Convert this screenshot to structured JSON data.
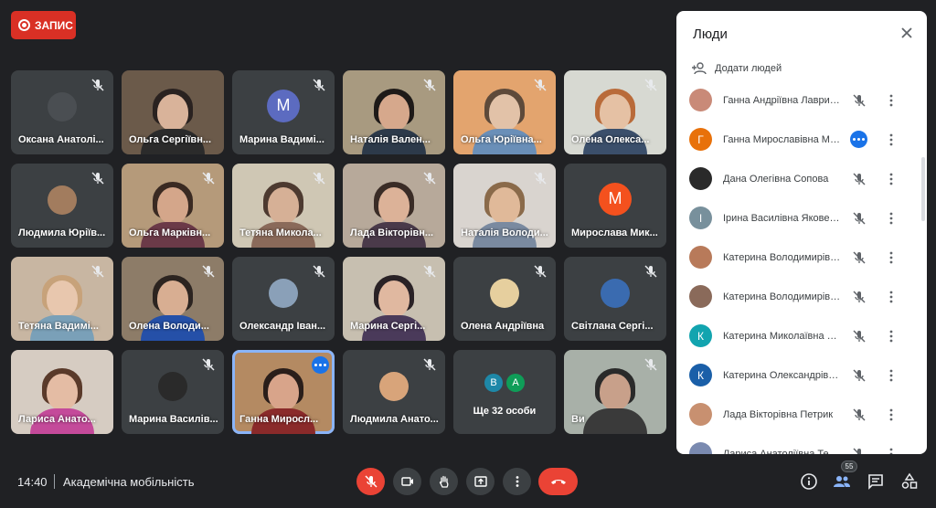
{
  "recording": {
    "label": "ЗАПИС"
  },
  "tiles": [
    {
      "name": "Оксана Анатолі...",
      "type": "photo-avatar",
      "mic_off": true,
      "bg": "#3c4043",
      "av": "#4a4e52"
    },
    {
      "name": "Ольга Сергіївн...",
      "type": "video",
      "mic_off": false,
      "bg": "#6b5a4a",
      "hair": "#2a2220",
      "skin": "#d9b39a",
      "body": "#2b2b2b"
    },
    {
      "name": "Марина Вадимі...",
      "type": "letter",
      "letter": "М",
      "color": "#5c6bc0",
      "mic_off": true,
      "bg": "#3c4043"
    },
    {
      "name": "Наталія Вален...",
      "type": "video",
      "mic_off": true,
      "bg": "#a89a80",
      "hair": "#1e1a18",
      "skin": "#d6a88c",
      "body": "#2d3a4a"
    },
    {
      "name": "Ольга Юріївна...",
      "type": "video",
      "mic_off": true,
      "bg": "#e3a46e",
      "hair": "#5e4a3a",
      "skin": "#e2c2a8",
      "body": "#6a8fb8"
    },
    {
      "name": "Олена Олекса...",
      "type": "video",
      "mic_off": true,
      "bg": "#d7d9d2",
      "hair": "#b96b3a",
      "skin": "#e5c1a4",
      "body": "#3b4f6b"
    },
    {
      "name": "Людмила Юріїв...",
      "type": "photo-avatar",
      "mic_off": true,
      "bg": "#3c4043",
      "av": "#a27c5e"
    },
    {
      "name": "Ольга Марківн...",
      "type": "video",
      "mic_off": true,
      "bg": "#b59a7a",
      "hair": "#3a2a22",
      "skin": "#d4a68a",
      "body": "#6b3a48"
    },
    {
      "name": "Тетяна Микола...",
      "type": "video",
      "mic_off": true,
      "bg": "#cfc7b4",
      "hair": "#4d3a30",
      "skin": "#d6b096",
      "body": "#8a6a5a"
    },
    {
      "name": "Лада Вікторівн...",
      "type": "video",
      "mic_off": true,
      "bg": "#b7a99a",
      "hair": "#3a2c26",
      "skin": "#dcb298",
      "body": "#4a3a4a"
    },
    {
      "name": "Наталія Володи...",
      "type": "video",
      "mic_off": true,
      "bg": "#d9d4cf",
      "hair": "#8a6a4a",
      "skin": "#e0b999",
      "body": "#7a8aa0"
    },
    {
      "name": "Мирослава Мик...",
      "type": "letter",
      "letter": "М",
      "color": "#f4511e",
      "mic_off": false,
      "bg": "#3c4043"
    },
    {
      "name": "Тетяна Вадимі...",
      "type": "video",
      "mic_off": true,
      "bg": "#c8b6a2",
      "hair": "#c7a27a",
      "skin": "#e8c7ae",
      "body": "#7aa0b8"
    },
    {
      "name": "Олена Володи...",
      "type": "video",
      "mic_off": true,
      "bg": "#8d7c68",
      "hair": "#2c2420",
      "skin": "#d8ae92",
      "body": "#2550a8"
    },
    {
      "name": "Олександр Іван...",
      "type": "photo-avatar",
      "mic_off": true,
      "bg": "#3c4043",
      "av": "#8aa0b8"
    },
    {
      "name": "Марина Сергі...",
      "type": "video",
      "mic_off": true,
      "bg": "#c7bfb0",
      "hair": "#2a2226",
      "skin": "#e0b8a0",
      "body": "#4a3a5a"
    },
    {
      "name": "Олена Андріївна",
      "type": "photo-avatar",
      "mic_off": true,
      "bg": "#3c4043",
      "av": "#e6cf9e"
    },
    {
      "name": "Світлана Сергі...",
      "type": "photo-avatar",
      "mic_off": true,
      "bg": "#3c4043",
      "av": "#3a6bb0"
    },
    {
      "name": "Лариса Анато...",
      "type": "video",
      "mic_off": false,
      "bg": "#d6ccc2",
      "hair": "#5a3a2a",
      "skin": "#e4bca4",
      "body": "#c44a9a"
    },
    {
      "name": "Марина Василів...",
      "type": "photo-avatar",
      "mic_off": true,
      "bg": "#3c4043",
      "av": "#2a2a2a"
    },
    {
      "name": "Ганна Миросл...",
      "type": "video",
      "mic_off": false,
      "speaking": true,
      "bg": "#b48a62",
      "hair": "#2a1e1a",
      "skin": "#d8a48a",
      "body": "#8a2a2a"
    },
    {
      "name": "Людмила Анато...",
      "type": "photo-avatar",
      "mic_off": true,
      "bg": "#3c4043",
      "av": "#d8a47a"
    },
    {
      "name": "Ще 32 особи",
      "type": "more",
      "avatars": [
        {
          "letter": "В",
          "color": "#1e88a8"
        },
        {
          "letter": "А",
          "color": "#0f9d58"
        }
      ],
      "mic_off": false,
      "bg": "#3c4043"
    },
    {
      "name": "Ви",
      "type": "video",
      "mic_off": true,
      "bg": "#a8b0a8",
      "hair": "#2a2a2a",
      "skin": "#c8a08a",
      "body": "#3a3a3a"
    }
  ],
  "panel": {
    "title": "Люди",
    "add_people": "Додати людей",
    "participants": [
      {
        "name": "Ганна Андріївна Лаврин...",
        "avatar_type": "photo",
        "color": "#c98a78",
        "mic": "off"
      },
      {
        "name": "Ганна Мирославівна Ме...",
        "avatar_type": "letter",
        "letter": "Г",
        "color": "#e8710a",
        "mic": "active"
      },
      {
        "name": "Дана Олегівна Сопова",
        "avatar_type": "photo",
        "color": "#2a2a2a",
        "mic": "off"
      },
      {
        "name": "Ірина Василівна Яковенко",
        "avatar_type": "letter",
        "letter": "І",
        "color": "#78909c",
        "mic": "off"
      },
      {
        "name": "Катерина Володимирівн...",
        "avatar_type": "photo",
        "color": "#b87a5a",
        "mic": "off"
      },
      {
        "name": "Катерина Володимирівн...",
        "avatar_type": "photo",
        "color": "#8a6a5a",
        "mic": "off"
      },
      {
        "name": "Катерина Миколаївна Кр...",
        "avatar_type": "letter",
        "letter": "К",
        "color": "#12a4af",
        "mic": "off"
      },
      {
        "name": "Катерина Олександрівн...",
        "avatar_type": "letter",
        "letter": "К",
        "color": "#1a5fa8",
        "mic": "off"
      },
      {
        "name": "Лада Вікторівна Петрик",
        "avatar_type": "photo",
        "color": "#c89070",
        "mic": "off"
      },
      {
        "name": "Лариса Анатоліївна Теря...",
        "avatar_type": "photo",
        "color": "#7a8ab0",
        "mic": "off"
      }
    ]
  },
  "bottom": {
    "time": "14:40",
    "meeting_name": "Академічна мобільність",
    "participants_count": "55"
  }
}
